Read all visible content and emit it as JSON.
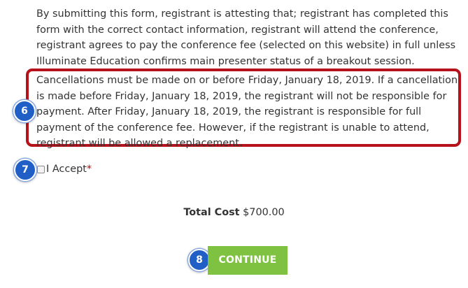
{
  "form": {
    "attestation_text": "By submitting this form, registrant is attesting that; registrant has completed this form with the correct contact information, registrant will attend the conference, registrant agrees to pay the conference fee (selected on this website) in full unless Illuminate Education confirms main presenter status of a breakout session.",
    "cancellation_text": "Cancellations must be made on or before Friday, January 18, 2019. If a cancellation is made before Friday, January 18, 2019, the registrant will not be responsible for payment. After Friday, January 18, 2019, the registrant is responsible for full payment of the conference fee. However, if the registrant is unable to attend, registrant will be allowed a replacement.",
    "accept_label": "I Accept",
    "accept_checked": false,
    "required_marker": "*",
    "total_label": "Total Cost",
    "total_value": "$700.00",
    "continue_label": "CONTINUE"
  },
  "annotations": {
    "step_6": "6",
    "step_7": "7",
    "step_8": "8"
  },
  "colors": {
    "highlight_border": "#b5121b",
    "badge_blue": "#1f5fc6",
    "continue_green": "#7fc241",
    "required_red": "#cc0000"
  }
}
